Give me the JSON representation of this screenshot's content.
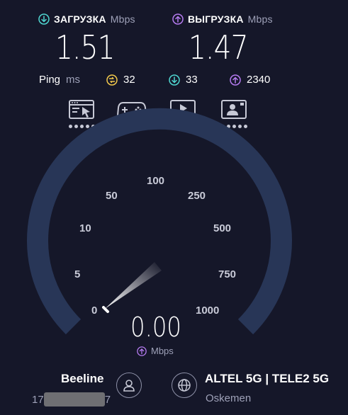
{
  "download": {
    "label": "ЗАГРУЗКА",
    "unit": "Mbps",
    "value": "1.51",
    "color": "#4fd6d0"
  },
  "upload": {
    "label": "ВЫГРУЗКА",
    "unit": "Mbps",
    "value": "1.47",
    "color": "#b57bf0"
  },
  "ping": {
    "label": "Ping",
    "unit": "ms",
    "idle": "32",
    "download": "33",
    "upload": "2340",
    "idle_color": "#f2c94c"
  },
  "icons": [
    "browser-cursor-icon",
    "gamepad-icon",
    "video-player-icon",
    "video-call-icon"
  ],
  "gauge": {
    "ticks": [
      "0",
      "5",
      "10",
      "50",
      "100",
      "250",
      "500",
      "750",
      "1000"
    ],
    "current": "0.00",
    "unit": "Mbps",
    "arc_color": "#283657"
  },
  "provider": {
    "name": "Beeline",
    "ip_start": "17",
    "ip_end": "7"
  },
  "server": {
    "name": "ALTEL 5G | TELE2 5G",
    "city": "Oskemen"
  }
}
